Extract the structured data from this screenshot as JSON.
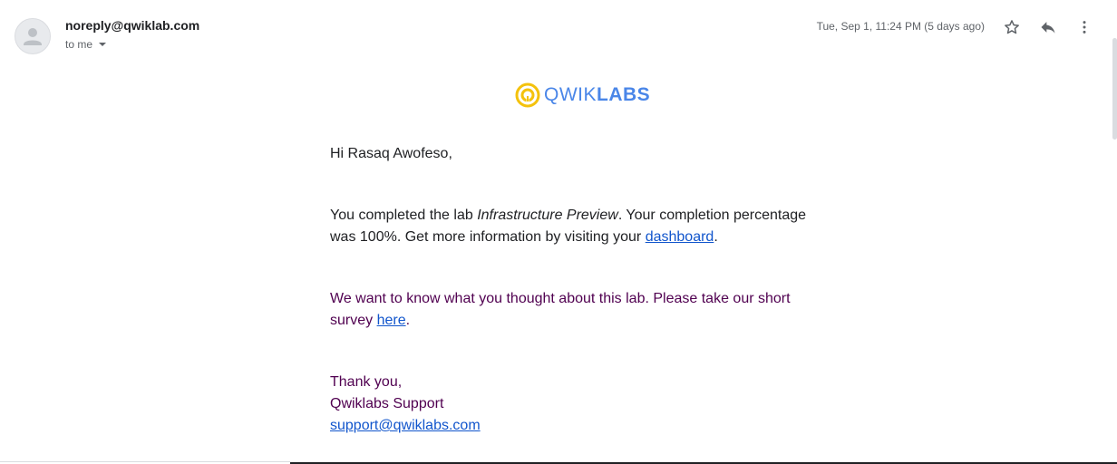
{
  "header": {
    "sender": "noreply@qwiklab.com",
    "recipient": "to me",
    "date": "Tue, Sep 1, 11:24 PM (5 days ago)"
  },
  "logo": {
    "part1": "QWIK",
    "part2": "LABS"
  },
  "email": {
    "greeting": "Hi Rasaq Awofeso,",
    "p1_before": "You completed the lab ",
    "p1_lab": "Infrastructure Preview",
    "p1_after": ". Your completion percentage was 100%. Get more information by visiting your ",
    "p1_link": "dashboard",
    "p1_end": ".",
    "p2_before": "We want to know what you thought about this lab. Please take our short survey ",
    "p2_link": "here",
    "p2_end": ".",
    "thanks": "Thank you,",
    "team": "Qwiklabs Support",
    "support_email": "support@qwiklabs.com"
  },
  "colors": {
    "link": "#1155cc",
    "quoted_text": "#500050",
    "logo_blue": "#4a86e8",
    "logo_yellow": "#f4c20d"
  },
  "icons": [
    "avatar-icon",
    "chevron-down-icon",
    "star-icon",
    "reply-icon",
    "more-vert-icon",
    "qwiklabs-logo-icon"
  ]
}
